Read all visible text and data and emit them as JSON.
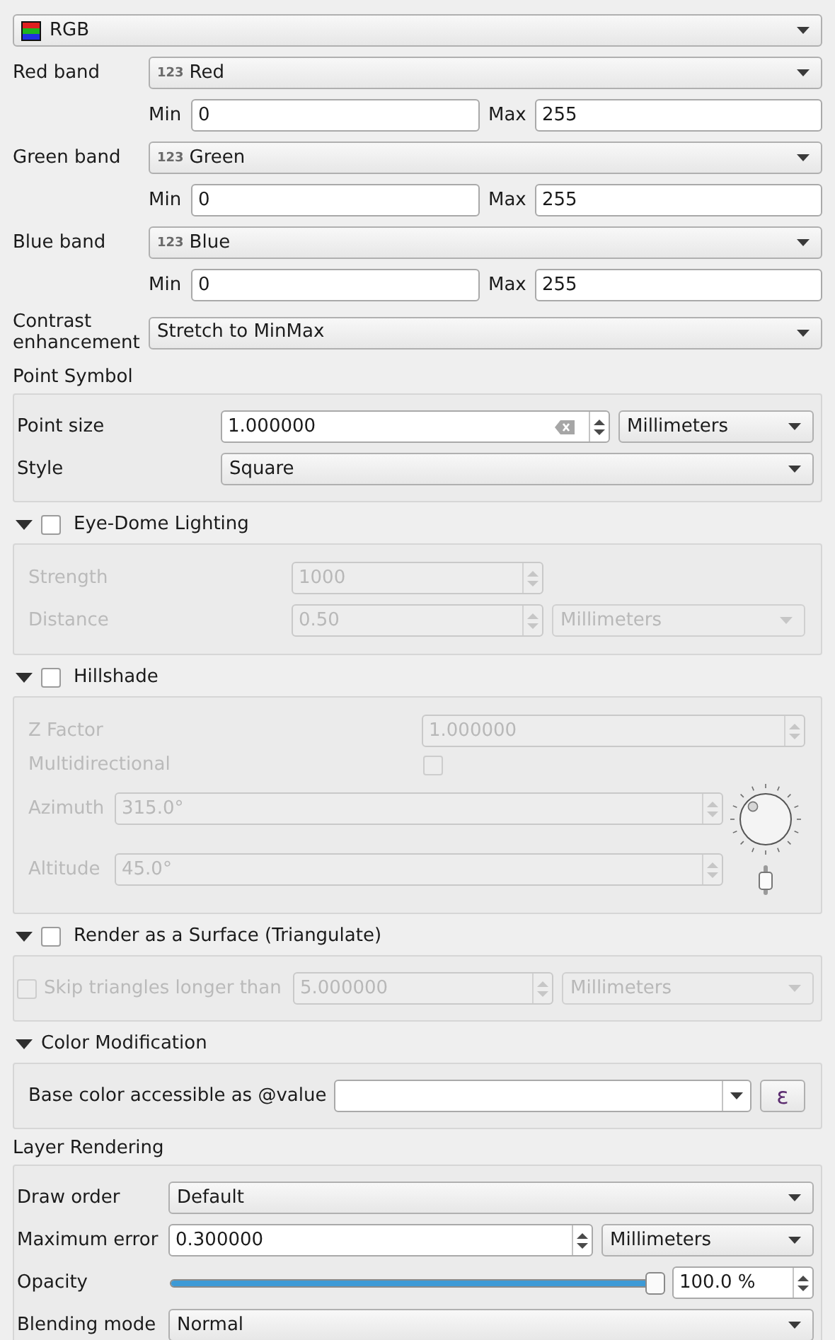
{
  "renderer": {
    "value": "RGB"
  },
  "bands": [
    {
      "label": "Red band",
      "badge": "123",
      "band": "Red",
      "min_label": "Min",
      "min": "0",
      "max_label": "Max",
      "max": "255"
    },
    {
      "label": "Green band",
      "badge": "123",
      "band": "Green",
      "min_label": "Min",
      "min": "0",
      "max_label": "Max",
      "max": "255"
    },
    {
      "label": "Blue band",
      "badge": "123",
      "band": "Blue",
      "min_label": "Min",
      "min": "0",
      "max_label": "Max",
      "max": "255"
    }
  ],
  "contrast": {
    "label": "Contrast enhancement",
    "value": "Stretch to MinMax"
  },
  "point_symbol": {
    "title": "Point Symbol",
    "size_label": "Point size",
    "size": "1.000000",
    "size_unit": "Millimeters",
    "style_label": "Style",
    "style": "Square"
  },
  "eye_dome": {
    "title": "Eye-Dome Lighting",
    "expanded": true,
    "checked": false,
    "strength_label": "Strength",
    "strength": "1000",
    "distance_label": "Distance",
    "distance": "0.50",
    "distance_unit": "Millimeters"
  },
  "hillshade": {
    "title": "Hillshade",
    "expanded": true,
    "checked": false,
    "z_factor_label": "Z Factor",
    "z_factor": "1.000000",
    "multidirectional_label": "Multidirectional",
    "multidirectional": false,
    "azimuth_label": "Azimuth",
    "azimuth": "315.0°",
    "altitude_label": "Altitude",
    "altitude": "45.0°"
  },
  "surface": {
    "title": "Render as a Surface (Triangulate)",
    "expanded": true,
    "checked": false,
    "skip_label": "Skip triangles longer than",
    "skip": false,
    "skip_value": "5.000000",
    "skip_unit": "Millimeters"
  },
  "color_modification": {
    "title": "Color Modification",
    "expanded": true,
    "base_label": "Base color accessible as @value",
    "expression_button": "ε"
  },
  "layer_rendering": {
    "title": "Layer Rendering",
    "draw_order_label": "Draw order",
    "draw_order": "Default",
    "max_error_label": "Maximum error",
    "max_error": "0.300000",
    "max_error_unit": "Millimeters",
    "opacity_label": "Opacity",
    "opacity_slider": {
      "level": 1
    },
    "opacity": "100.0 %",
    "blending_label": "Blending mode",
    "blending": "Normal"
  }
}
